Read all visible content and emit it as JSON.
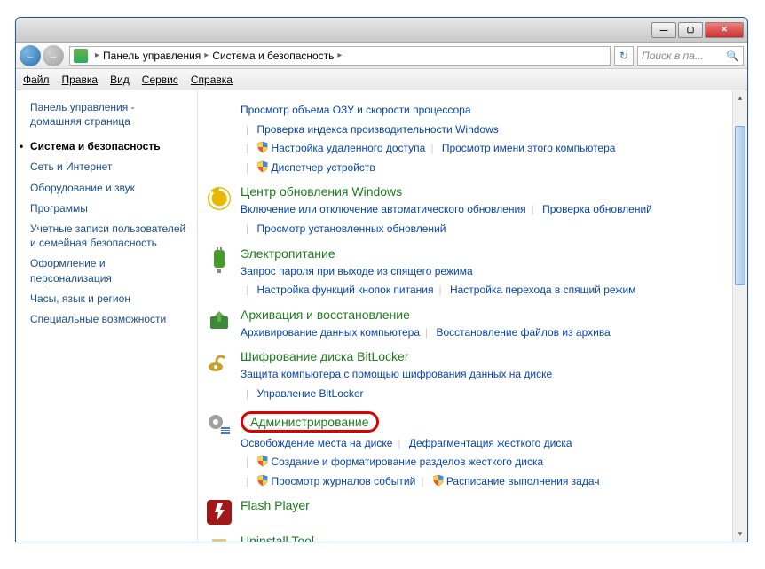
{
  "titlebar": {
    "min": "—",
    "max": "▢",
    "close": "✕"
  },
  "nav": {
    "back": "←",
    "fwd": "→",
    "breadcrumb": [
      "Панель управления",
      "Система и безопасность"
    ],
    "refresh": "↻",
    "search_placeholder": "Поиск в па..."
  },
  "menu": [
    "Файл",
    "Правка",
    "Вид",
    "Сервис",
    "Справка"
  ],
  "sidebar": {
    "home": "Панель управления - домашняя страница",
    "items": [
      {
        "label": "Система и безопасность",
        "active": true
      },
      {
        "label": "Сеть и Интернет"
      },
      {
        "label": "Оборудование и звук"
      },
      {
        "label": "Программы"
      },
      {
        "label": "Учетные записи пользователей и семейная безопасность"
      },
      {
        "label": "Оформление и персонализация"
      },
      {
        "label": "Часы, язык и регион"
      },
      {
        "label": "Специальные возможности"
      }
    ]
  },
  "sections": [
    {
      "title": "",
      "links": [
        {
          "t": "Просмотр объема ОЗУ и скорости процессора"
        },
        {
          "t": "Проверка индекса производительности Windows"
        },
        {
          "t": "Настройка удаленного доступа",
          "shield": true
        },
        {
          "t": "Просмотр имени этого компьютера"
        },
        {
          "t": "Диспетчер устройств",
          "shield": true
        }
      ]
    },
    {
      "title": "Центр обновления Windows",
      "icon": "wu",
      "links": [
        {
          "t": "Включение или отключение автоматического обновления"
        },
        {
          "t": "Проверка обновлений"
        },
        {
          "t": "Просмотр установленных обновлений"
        }
      ]
    },
    {
      "title": "Электропитание",
      "icon": "power",
      "links": [
        {
          "t": "Запрос пароля при выходе из спящего режима"
        },
        {
          "t": "Настройка функций кнопок питания"
        },
        {
          "t": "Настройка перехода в спящий режим"
        }
      ]
    },
    {
      "title": "Архивация и восстановление",
      "icon": "backup",
      "links": [
        {
          "t": "Архивирование данных компьютера"
        },
        {
          "t": "Восстановление файлов из архива"
        }
      ]
    },
    {
      "title": "Шифрование диска BitLocker",
      "icon": "bitlocker",
      "links": [
        {
          "t": "Защита компьютера с помощью шифрования данных на диске"
        },
        {
          "t": "Управление BitLocker"
        }
      ]
    },
    {
      "title": "Администрирование",
      "icon": "admin",
      "highlight": true,
      "links": [
        {
          "t": "Освобождение места на диске"
        },
        {
          "t": "Дефрагментация жесткого диска"
        },
        {
          "t": "Создание и форматирование разделов жесткого диска",
          "shield": true
        },
        {
          "t": "Просмотр журналов событий",
          "shield": true
        },
        {
          "t": "Расписание выполнения задач",
          "shield": true
        }
      ]
    },
    {
      "title": "Flash Player",
      "icon": "flash",
      "links": []
    },
    {
      "title": "Uninstall Tool",
      "icon": "uninstall",
      "links": []
    }
  ]
}
